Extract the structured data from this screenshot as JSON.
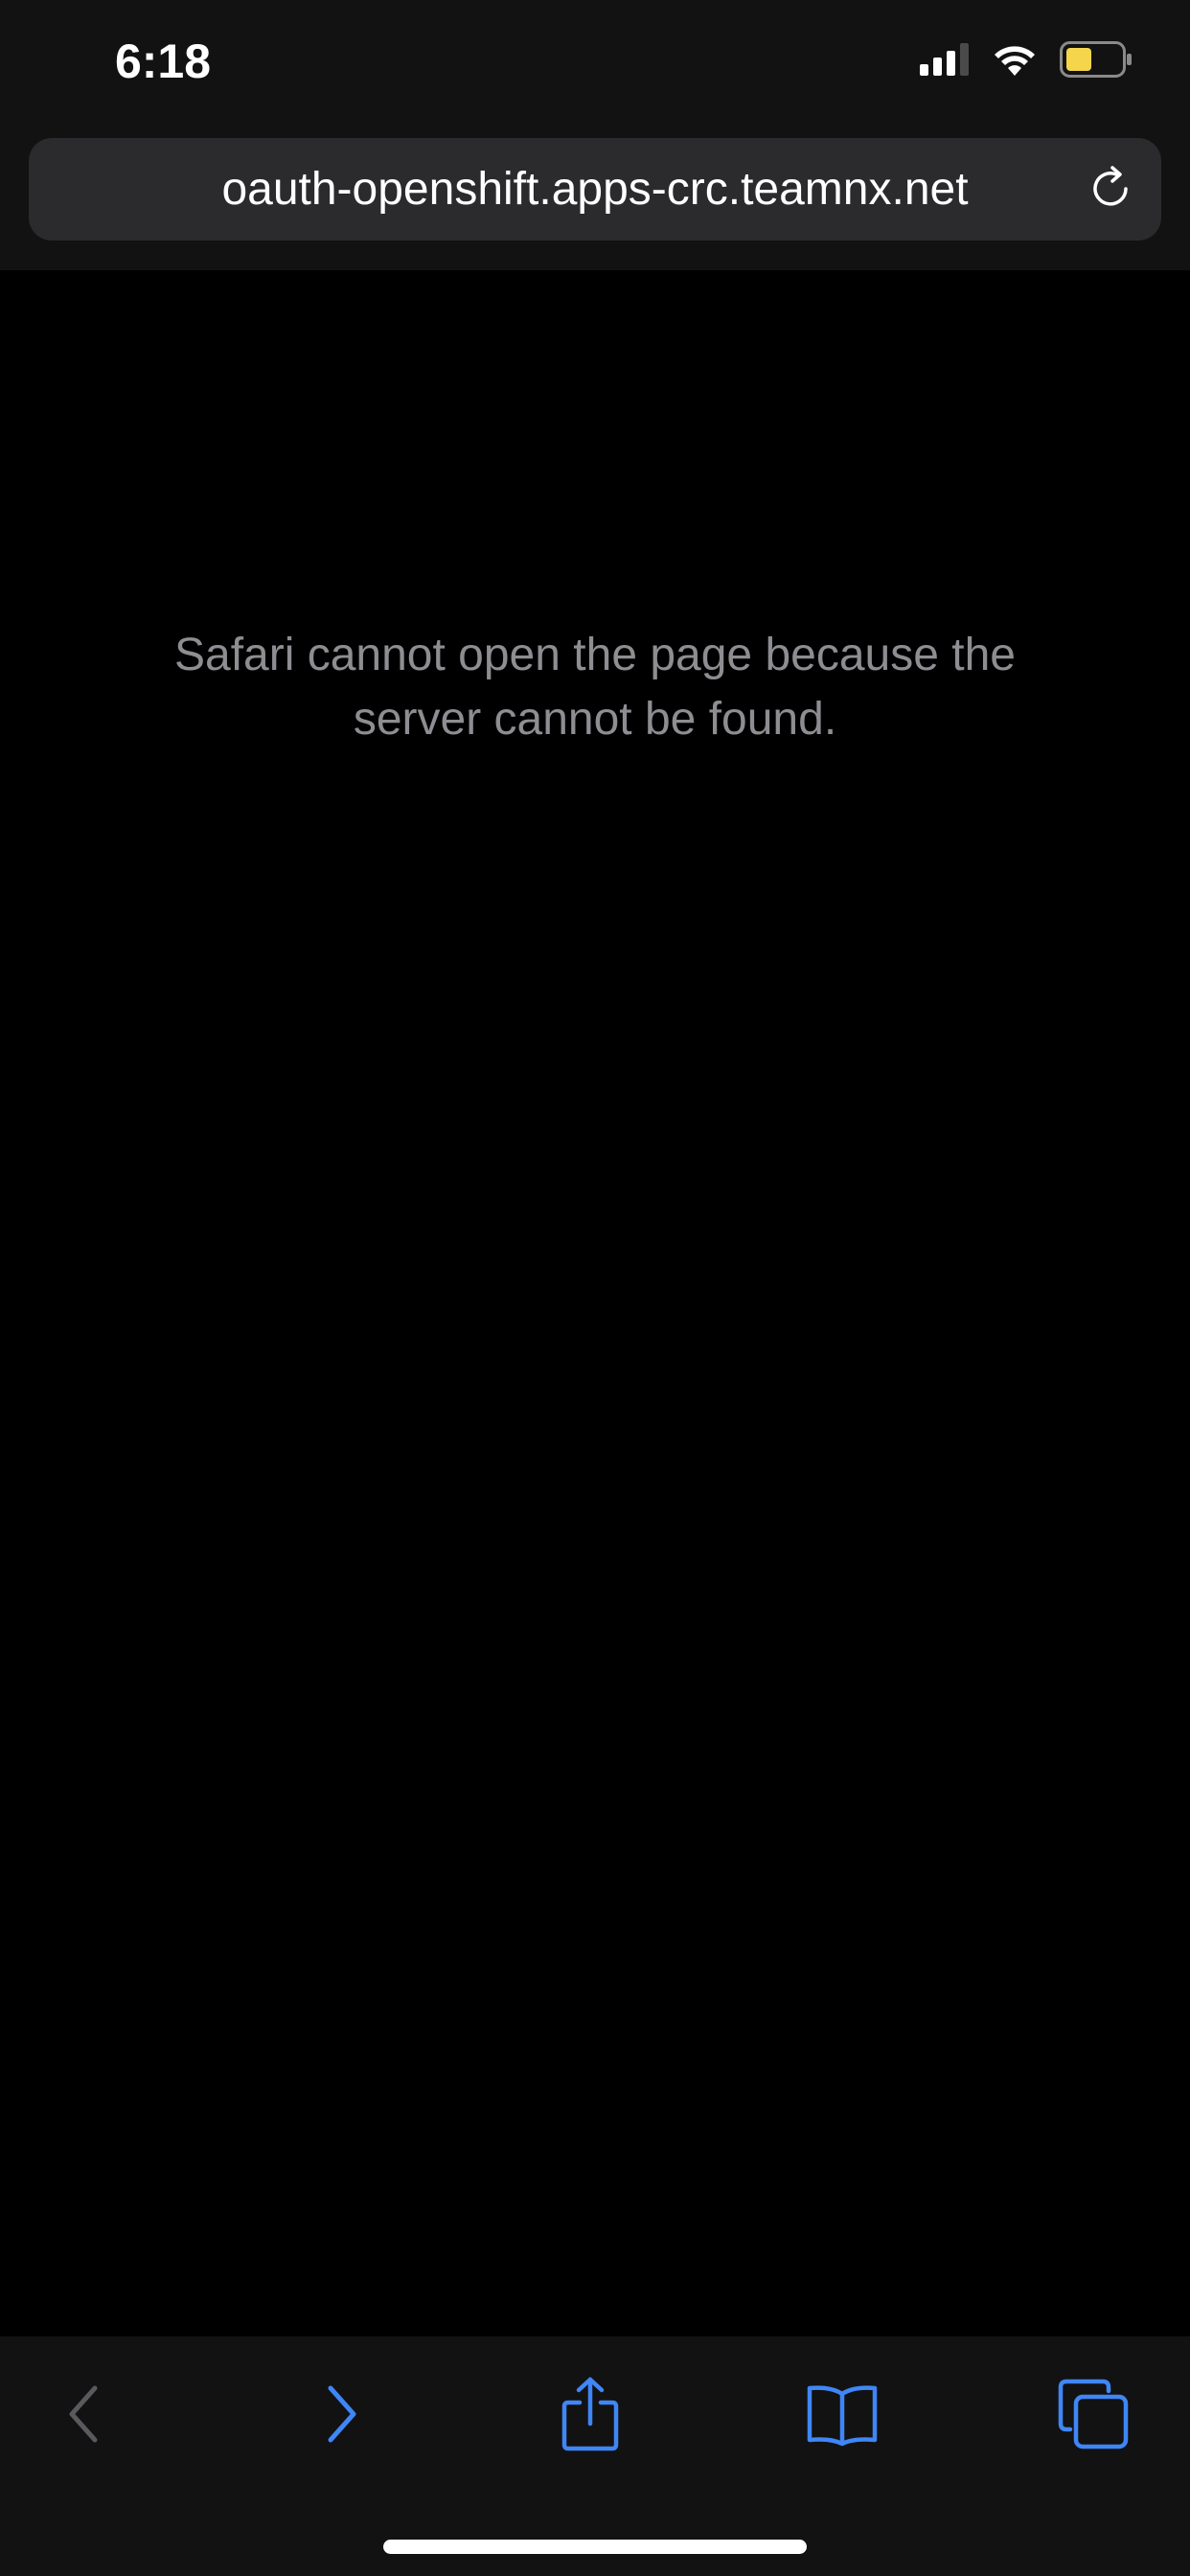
{
  "status_bar": {
    "time": "6:18",
    "signal_icon": "cellular-signal-icon",
    "wifi_icon": "wifi-icon",
    "battery_icon": "battery-icon",
    "battery_color": "#f5d54c"
  },
  "address_bar": {
    "url": "oauth-openshift.apps-crc.teamnx.net",
    "reload_icon": "reload-icon"
  },
  "page": {
    "error_line1": "Safari cannot open the page because the",
    "error_line2": "server cannot be found."
  },
  "toolbar": {
    "back_icon": "chevron-left-icon",
    "forward_icon": "chevron-right-icon",
    "share_icon": "share-icon",
    "bookmarks_icon": "book-icon",
    "tabs_icon": "tabs-icon",
    "accent_color": "#3f86f6",
    "disabled_color": "#5a5a5e"
  }
}
